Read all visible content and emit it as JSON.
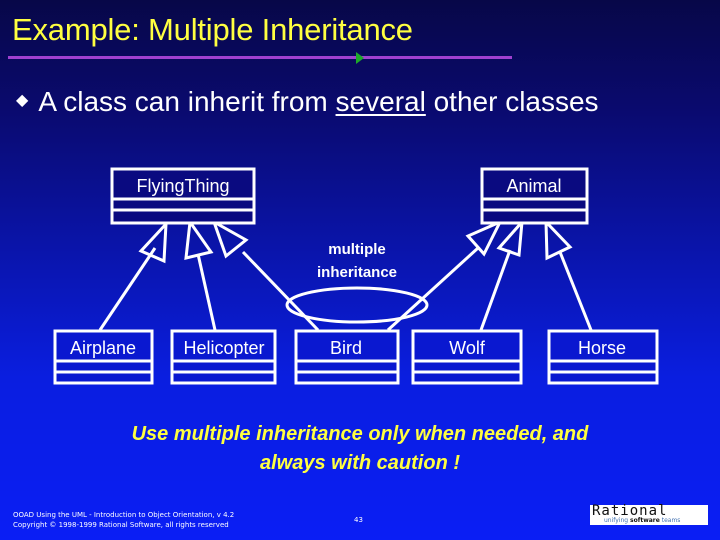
{
  "slide": {
    "title": "Example: Multiple Inheritance",
    "bullet": {
      "icon": "diamond-bullet-icon",
      "text_before": "A class can inherit from ",
      "text_underlined": "several",
      "text_after": " other classes"
    },
    "caution": {
      "line1": "Use multiple inheritance only when needed, and",
      "line2": "always with caution !"
    },
    "footer": {
      "line1": "OOAD Using the UML - Introduction to Object Orientation, v 4.2",
      "line2": "Copyright © 1998-1999 Rational Software, all rights reserved",
      "page_number": "43"
    },
    "logo": {
      "name": "Rational",
      "tagline_prefix": "unifying ",
      "tagline_bold": "software",
      "tagline_suffix": " teams"
    },
    "colors": {
      "title": "#ffff40",
      "rule": "#a040d0",
      "rule_marker": "#1eaa2a",
      "text": "#ffffff",
      "caution": "#ffff40"
    }
  },
  "diagram": {
    "superclasses": [
      {
        "id": "flyingthing",
        "name": "FlyingThing"
      },
      {
        "id": "animal",
        "name": "Animal"
      }
    ],
    "subclasses": [
      {
        "id": "airplane",
        "name": "Airplane",
        "parents": [
          "flyingthing"
        ]
      },
      {
        "id": "helicopter",
        "name": "Helicopter",
        "parents": [
          "flyingthing"
        ]
      },
      {
        "id": "bird",
        "name": "Bird",
        "parents": [
          "flyingthing",
          "animal"
        ]
      },
      {
        "id": "wolf",
        "name": "Wolf",
        "parents": [
          "animal"
        ]
      },
      {
        "id": "horse",
        "name": "Horse",
        "parents": [
          "animal"
        ]
      }
    ],
    "annotation": {
      "line1": "multiple",
      "line2": "inheritance",
      "highlights": "bird"
    }
  }
}
